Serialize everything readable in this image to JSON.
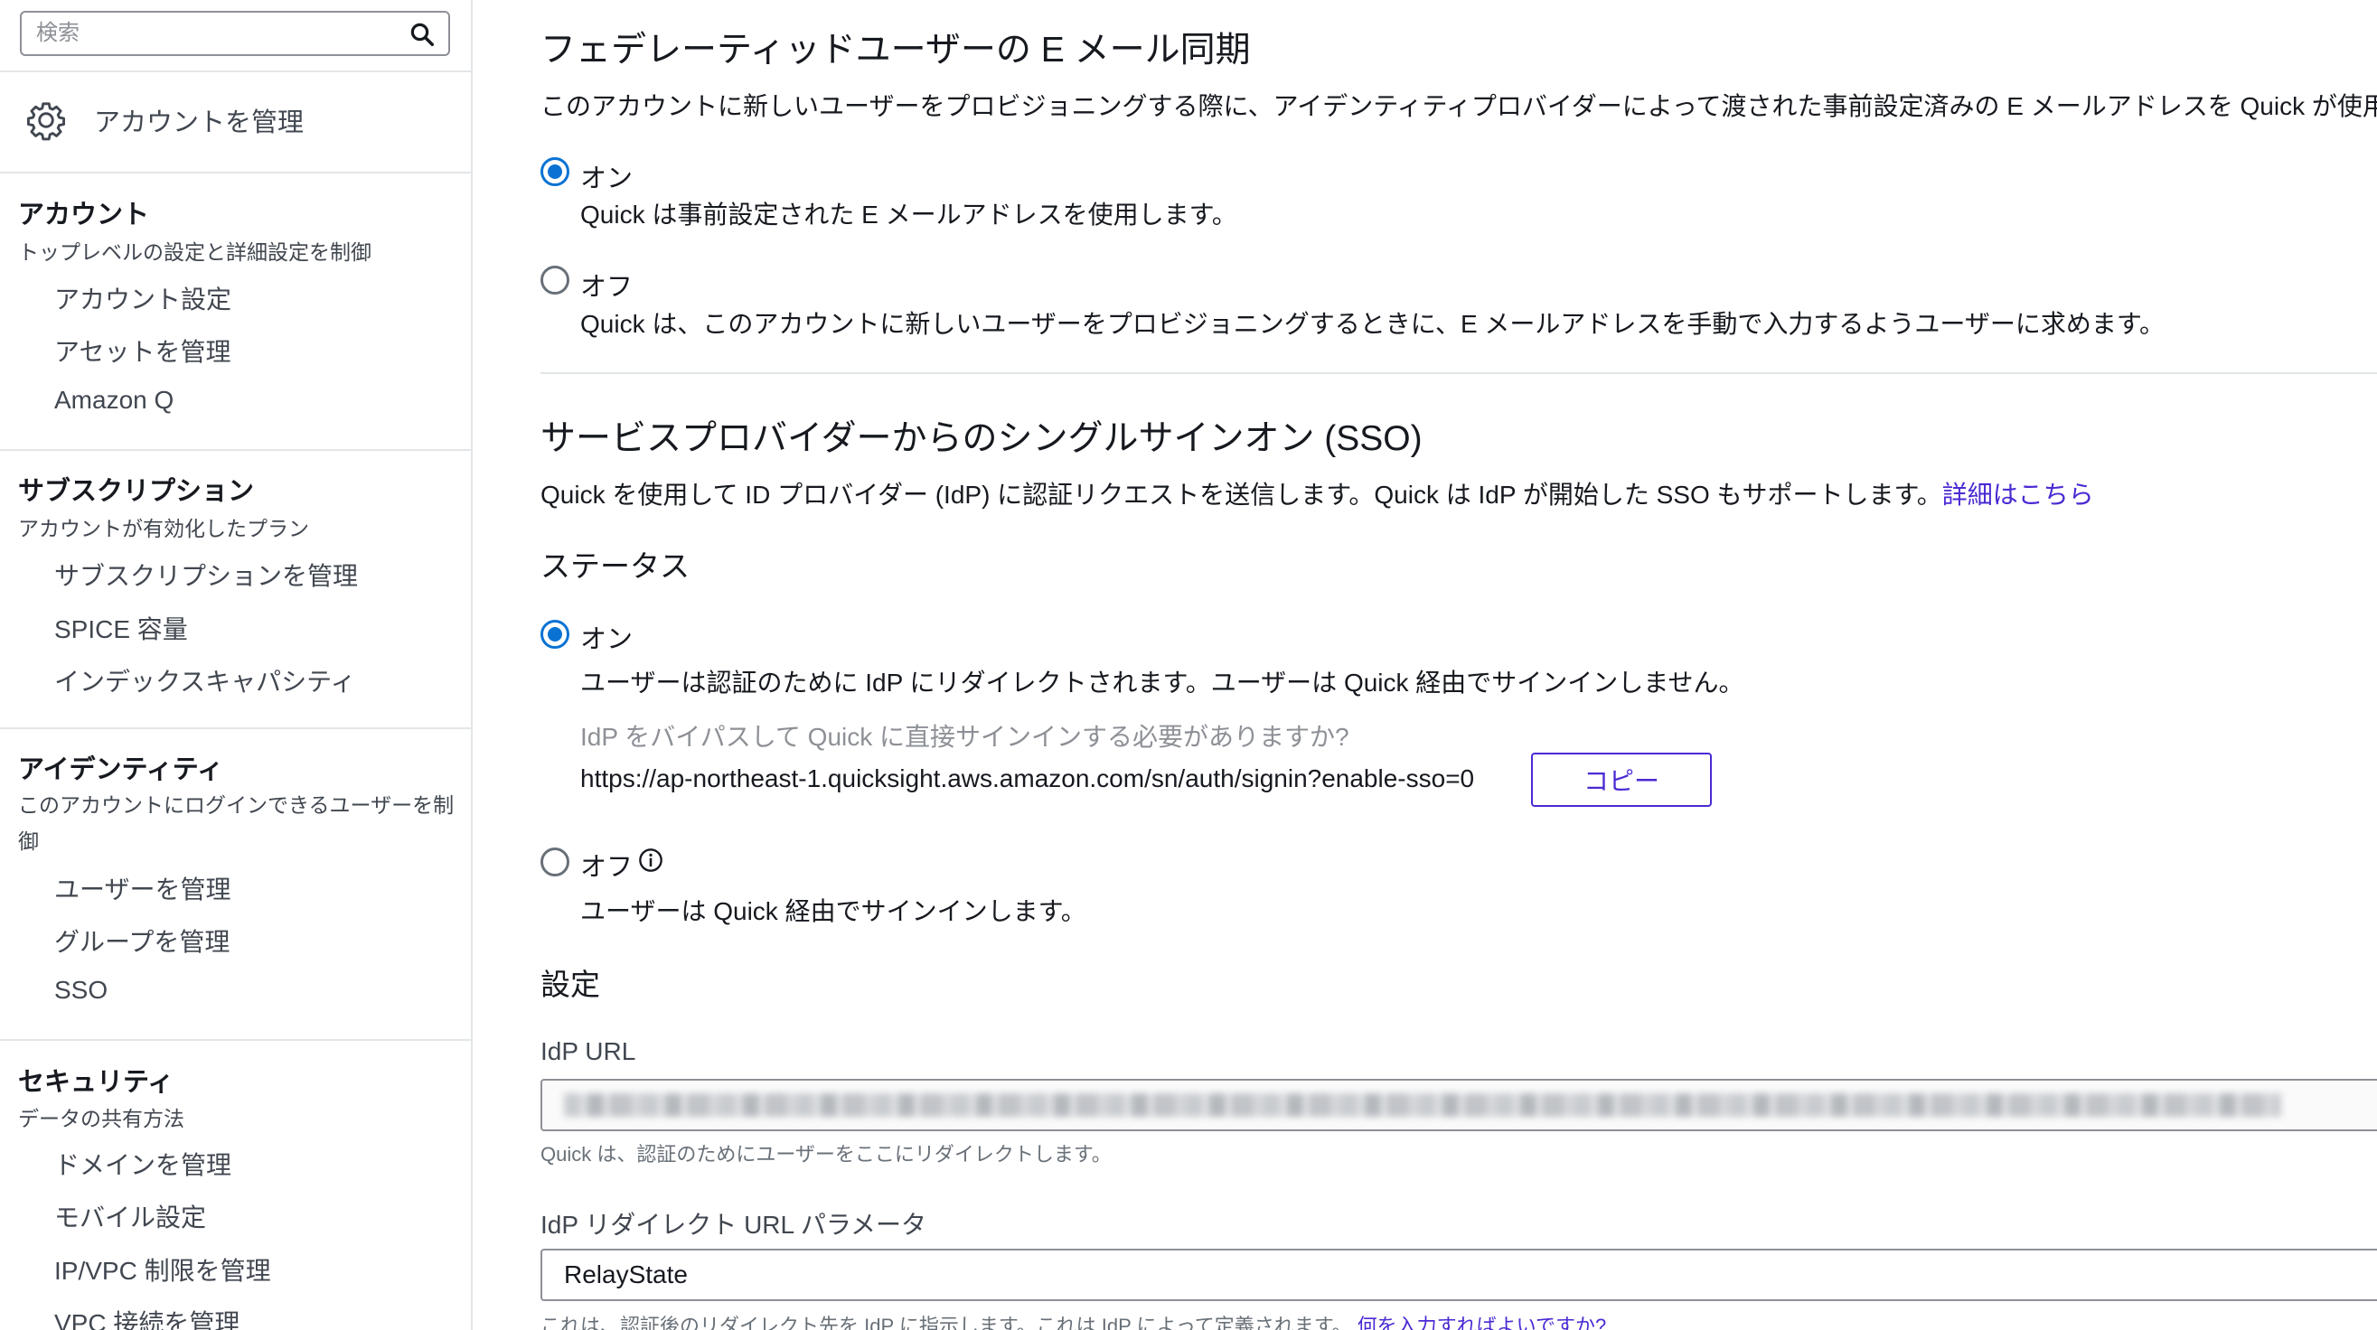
{
  "search": {
    "placeholder": "検索"
  },
  "sidebar": {
    "manage_account": "アカウントを管理",
    "sections": [
      {
        "title": "アカウント",
        "description": "トップレベルの設定と詳細設定を制御",
        "items": [
          "アカウント設定",
          "アセットを管理",
          "Amazon Q"
        ]
      },
      {
        "title": "サブスクリプション",
        "description": "アカウントが有効化したプラン",
        "items": [
          "サブスクリプションを管理",
          "SPICE 容量",
          "インデックスキャパシティ"
        ]
      },
      {
        "title": "アイデンティティ",
        "description": "このアカウントにログインできるユーザーを制御",
        "items": [
          "ユーザーを管理",
          "グループを管理",
          "SSO"
        ]
      },
      {
        "title": "セキュリティ",
        "description": "データの共有方法",
        "items": [
          "ドメインを管理",
          "モバイル設定",
          "IP/VPC 制限を管理",
          "VPC 接続を管理"
        ]
      }
    ]
  },
  "email_sync": {
    "title": "フェデレーティッドユーザーの E メール同期",
    "description": "このアカウントに新しいユーザーをプロビジョニングする際に、アイデンティティプロバイダーによって渡された事前設定済みの E メールアドレスを Quick が使用",
    "on_label": "オン",
    "on_desc": "Quick は事前設定された E メールアドレスを使用します。",
    "off_label": "オフ",
    "off_desc": "Quick は、このアカウントに新しいユーザーをプロビジョニングするときに、E メールアドレスを手動で入力するようユーザーに求めます。"
  },
  "sso": {
    "title": "サービスプロバイダーからのシングルサインオン (SSO)",
    "description": "Quick を使用して ID プロバイダー (IdP) に認証リクエストを送信します。Quick は IdP が開始した SSO もサポートします。",
    "learn_more": "詳細はこちら",
    "status_title": "ステータス",
    "on_label": "オン",
    "on_desc": "ユーザーは認証のために IdP にリダイレクトされます。ユーザーは Quick 経由でサインインしません。",
    "bypass_question": "IdP をバイパスして Quick に直接サインインする必要がありますか?",
    "bypass_url": "https://ap-northeast-1.quicksight.aws.amazon.com/sn/auth/signin?enable-sso=0",
    "copy_label": "コピー",
    "off_label": "オフ",
    "off_desc": "ユーザーは Quick 経由でサインインします。"
  },
  "settings": {
    "title": "設定",
    "idp_url_label": "IdP URL",
    "idp_url_hint": "Quick は、認証のためにユーザーをここにリダイレクトします。",
    "redirect_param_label": "IdP リダイレクト URL パラメータ",
    "redirect_param_value": "RelayState",
    "redirect_param_hint": "これは、認証後のリダイレクト先を IdP に指示します。これは IdP によって定義されます。",
    "redirect_param_help": "何を入力すればよいですか?"
  }
}
